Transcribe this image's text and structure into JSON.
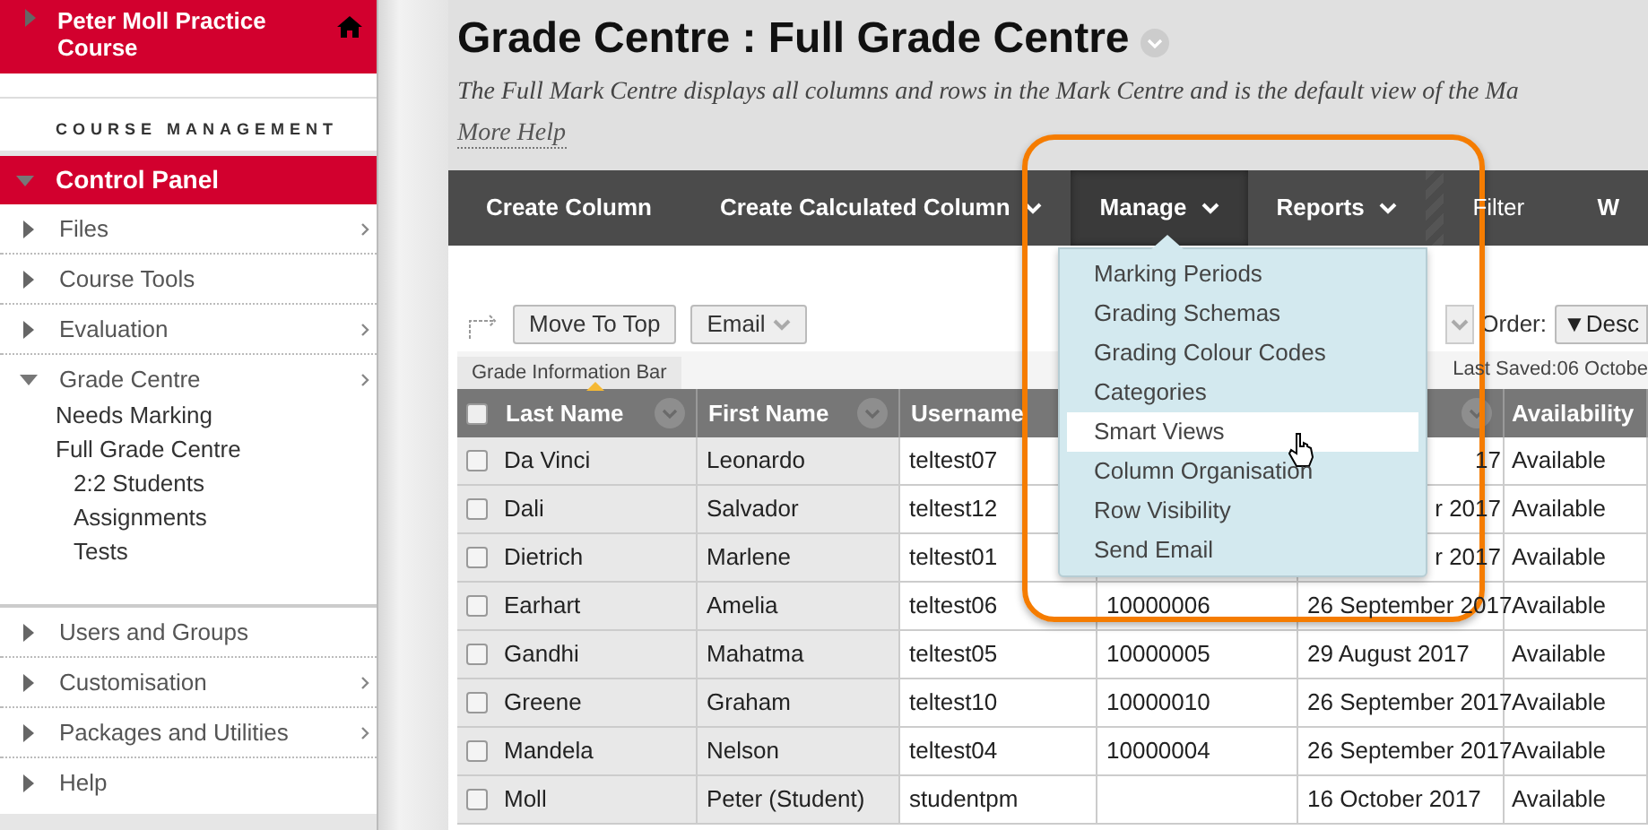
{
  "sidebar": {
    "course_title": "Peter Moll Practice Course",
    "section_heading": "COURSE MANAGEMENT",
    "panel": {
      "label": "Control Panel",
      "expanded": true
    },
    "items": [
      {
        "label": "Files",
        "expanded": false,
        "submenu": true
      },
      {
        "label": "Course Tools",
        "expanded": false,
        "submenu": false
      },
      {
        "label": "Evaluation",
        "expanded": false,
        "submenu": true
      },
      {
        "label": "Grade Centre",
        "expanded": true,
        "submenu": true,
        "children": [
          {
            "label": "Needs Marking"
          },
          {
            "label": "Full Grade Centre",
            "children": [
              {
                "label": "2:2 Students"
              },
              {
                "label": "Assignments"
              },
              {
                "label": "Tests"
              }
            ]
          }
        ]
      },
      {
        "label": "Users and Groups",
        "expanded": false,
        "submenu": false
      },
      {
        "label": "Customisation",
        "expanded": false,
        "submenu": true
      },
      {
        "label": "Packages and Utilities",
        "expanded": false,
        "submenu": true
      },
      {
        "label": "Help",
        "expanded": false,
        "submenu": false
      }
    ]
  },
  "page": {
    "title": "Grade Centre : Full Grade Centre",
    "description": "The Full Mark Centre displays all columns and rows in the Mark Centre and is the default view of the Ma",
    "help_link": "More Help"
  },
  "toolbar": [
    {
      "label": "Create Column",
      "dropdown": false,
      "selected": false
    },
    {
      "label": "Create Calculated Column",
      "dropdown": true,
      "selected": false
    },
    {
      "label": "Manage",
      "dropdown": true,
      "selected": true
    },
    {
      "label": "Reports",
      "dropdown": true,
      "selected": false
    },
    {
      "label": "Filter",
      "dropdown": false,
      "selected": false
    },
    {
      "label": "W",
      "dropdown": false,
      "selected": false
    }
  ],
  "manage_menu": [
    {
      "label": "Marking Periods",
      "selected": false
    },
    {
      "label": "Grading Schemas",
      "selected": false
    },
    {
      "label": "Grading Colour Codes",
      "selected": false
    },
    {
      "label": "Categories",
      "selected": false
    },
    {
      "label": "Smart Views",
      "selected": true
    },
    {
      "label": "Column Organisation",
      "selected": false
    },
    {
      "label": "Row Visibility",
      "selected": false
    },
    {
      "label": "Send Email",
      "selected": false
    }
  ],
  "action_bar": {
    "buttons": [
      "Move To Top",
      "Email"
    ],
    "order_label": "Order:",
    "order_button": "▼Desc"
  },
  "info_bar": {
    "tab": "Grade Information Bar",
    "last_saved": "Last Saved:06 Octobe"
  },
  "table": {
    "all_checked": false,
    "columns": [
      "Last Name",
      "First Name",
      "Username",
      "Availability"
    ],
    "rows": [
      {
        "checked": false,
        "under_menu": true,
        "last_name": "Da Vinci",
        "first_name": "Leonardo",
        "username": "teltest07",
        "column_5": "17",
        "availability": "Available"
      },
      {
        "checked": false,
        "under_menu": true,
        "last_name": "Dali",
        "first_name": "Salvador",
        "username": "teltest12",
        "column_5": "r 2017",
        "availability": "Available"
      },
      {
        "checked": false,
        "under_menu": true,
        "last_name": "Dietrich",
        "first_name": "Marlene",
        "username": "teltest01",
        "column_5": "r 2017",
        "availability": "Available"
      },
      {
        "checked": false,
        "under_menu": false,
        "last_name": "Earhart",
        "first_name": "Amelia",
        "username": "teltest06",
        "column_4": "10000006",
        "column_5": "26 September 2017",
        "availability": "Available"
      },
      {
        "checked": false,
        "under_menu": false,
        "last_name": "Gandhi",
        "first_name": "Mahatma",
        "username": "teltest05",
        "column_4": "10000005",
        "column_5": "29 August 2017",
        "availability": "Available"
      },
      {
        "checked": false,
        "under_menu": false,
        "last_name": "Greene",
        "first_name": "Graham",
        "username": "teltest10",
        "column_4": "10000010",
        "column_5": "26 September 2017",
        "availability": "Available"
      },
      {
        "checked": false,
        "under_menu": false,
        "last_name": "Mandela",
        "first_name": "Nelson",
        "username": "teltest04",
        "column_4": "10000004",
        "column_5": "26 September 2017",
        "availability": "Available"
      },
      {
        "checked": false,
        "under_menu": false,
        "last_name": "Moll",
        "first_name": "Peter (Student)",
        "username": "studentpm",
        "column_5": "16 October 2017",
        "availability": "Available"
      }
    ]
  }
}
